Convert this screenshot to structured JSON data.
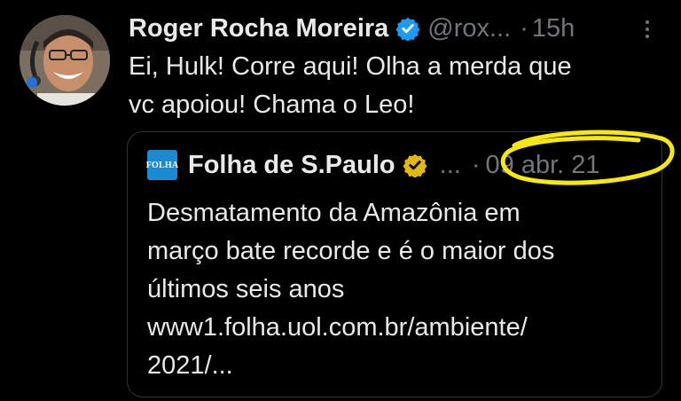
{
  "tweet": {
    "author_name": "Roger Rocha Moreira",
    "handle": "@rox...",
    "separator": "·",
    "time": "15h",
    "text": "Ei, Hulk! Corre aqui! Olha a merda que\nvc apoiou! Chama o Leo!",
    "avatar_icon": "profile-photo"
  },
  "quote": {
    "logo_text": "FOLHA",
    "author_name": "Folha de S.Paulo",
    "ellipsis": "...",
    "separator": "·",
    "date": "09 abr. 21",
    "text": "Desmatamento da Amazônia em\nmarço bate recorde e é o maior dos\núltimos seis anos\nwww1.folha.uol.com.br/ambiente/\n2021/..."
  },
  "colors": {
    "background": "#000000",
    "text": "#e7e9ea",
    "muted": "#71767b",
    "verified_blue": "#1d9bf0",
    "verified_gold": "#e2b719",
    "folha_blue": "#1c8ad1",
    "highlight": "#f5e71c"
  }
}
